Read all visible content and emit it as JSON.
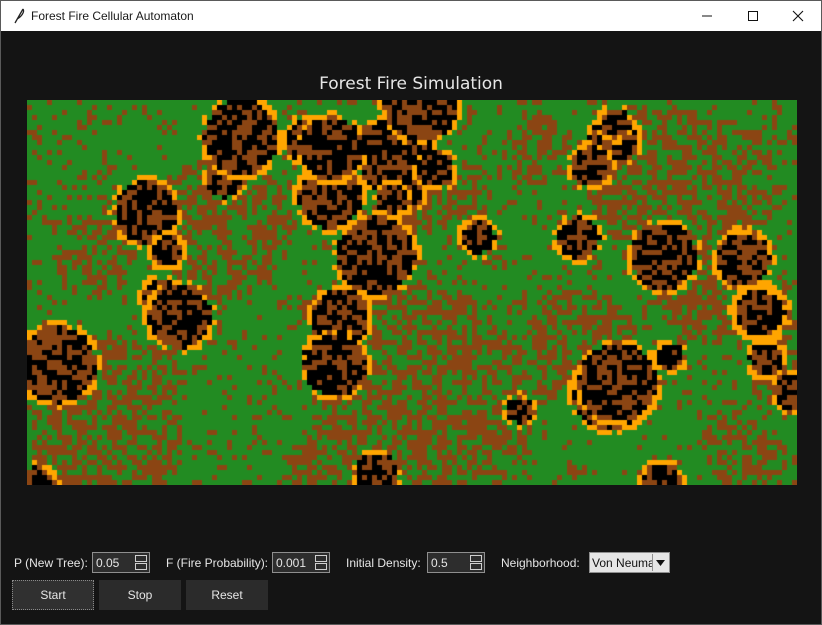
{
  "window": {
    "title": "Forest Fire Cellular Automaton"
  },
  "heading": "Forest Fire Simulation",
  "simulation": {
    "grid_cols": 154,
    "grid_rows": 77,
    "colors": {
      "tree": "#228b22",
      "empty": "#8b4513",
      "burning": "#ffa500",
      "burnt": "#000000"
    }
  },
  "controls": {
    "p_label": "P (New Tree):",
    "p_value": "0.05",
    "f_label": "F (Fire Probability):",
    "f_value": "0.001",
    "density_label": "Initial Density:",
    "density_value": "0.5",
    "neighborhood_label": "Neighborhood:",
    "neighborhood_value": "Von Neumann"
  },
  "buttons": {
    "start": "Start",
    "stop": "Stop",
    "reset": "Reset"
  }
}
